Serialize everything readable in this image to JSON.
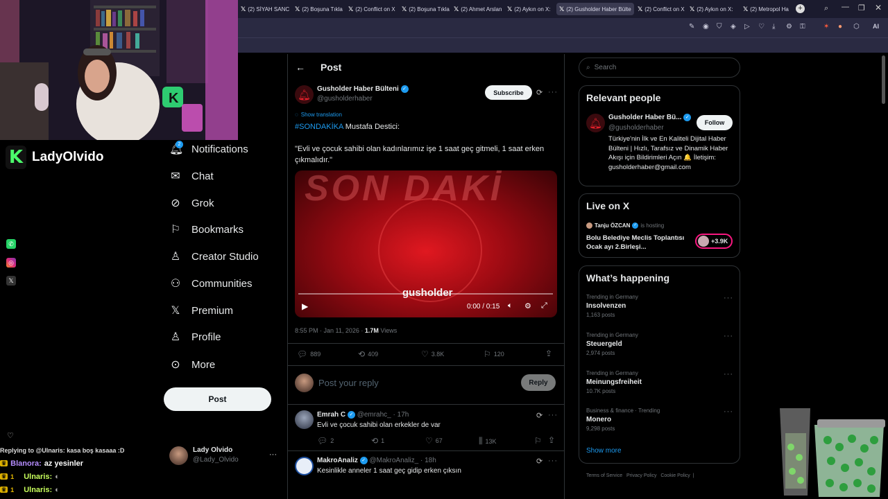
{
  "browser": {
    "tabs": [
      "(2) SİYAH SANC",
      "(2) Boşuna Tıkla",
      "(2) Conflict on X",
      "(2) Boşuna Tıkla",
      "(2) Ahmet Arslan",
      "(2) Aykın on X:",
      "(2) Gusholder Haber Bülte",
      "(2) Conflict on X",
      "(2) Aykın on X:",
      "(2) Metropol Ha"
    ],
    "active_tab_index": 6,
    "new_tab": "+",
    "ai_label": "AI"
  },
  "stream": {
    "streamer": "LadyOlvido",
    "logo_letter": "K",
    "chat": [
      {
        "user": "Replying to @Ulnaris: kasa boş kasaaa :D",
        "color": "#dddddd"
      },
      {
        "user": "Blanora:",
        "text": "az yesinler",
        "color": "#b58cff"
      },
      {
        "user": "Ulnaris:",
        "text": "",
        "color": "#c8ff5c"
      },
      {
        "user": "Ulnaris:",
        "text": "",
        "color": "#c8ff5c"
      }
    ],
    "badge": "1"
  },
  "nav": {
    "notifications": "Notifications",
    "notifications_badge": "2",
    "chat": "Chat",
    "grok": "Grok",
    "bookmarks": "Bookmarks",
    "creator_studio": "Creator Studio",
    "communities": "Communities",
    "premium": "Premium",
    "profile": "Profile",
    "more": "More",
    "post": "Post",
    "account_name": "Lady Olvido",
    "account_handle": "@Lady_Olvido"
  },
  "post": {
    "header": "Post",
    "author": "Gusholder Haber Bülteni",
    "handle": "@gusholderhaber",
    "subscribe": "Subscribe",
    "show_translation": "Show translation",
    "hashtag": "#SONDAKİKA",
    "text_line1": " Mustafa Destici:",
    "quote": "\"Evli ve çocuk sahibi olan kadınlarımız işe 1 saat geç gitmeli, 1 saat erken çıkmalıdır.\"",
    "video_brand": "gusholder",
    "video_overlay_text": "SON DAKİ",
    "video_time": "0:00 / 0:15",
    "video_progress": 0,
    "timestamp": "8:55 PM · Jan 11, 2026 · ",
    "views_count": "1.7M",
    "views_label": " Views",
    "replies": "889",
    "reposts": "409",
    "likes": "3.8K",
    "bookmarks": "120",
    "reply_placeholder": "Post your reply",
    "reply_button": "Reply"
  },
  "replies": [
    {
      "name": "Emrah C",
      "handle": "@emrahc_",
      "time": "· 17h",
      "text": "Evli ve çocuk sahibi olan erkekler de var",
      "replies": "2",
      "reposts": "1",
      "likes": "67",
      "views": "13K"
    },
    {
      "name": "MakroAnaliz",
      "handle": "@MakroAnaliz_",
      "time": "· 18h",
      "text": "Kesinlikle anneler 1 saat geç gidip erken çıksın"
    }
  ],
  "sidebar": {
    "search_placeholder": "Search",
    "relevant_title": "Relevant people",
    "rp_name": "Gusholder Haber Bü...",
    "rp_handle": "@gusholderhaber",
    "rp_follow": "Follow",
    "rp_bio": "Türkiye'nin İlk ve En Kaliteli Dijital Haber Bülteni | Hızlı, Tarafsız ve Dinamik Haber Akışı için Bildirimleri Açın 🔔 İletişim: gusholderhaber@gmail.com",
    "live_title": "Live on X",
    "live_host": "Tanju ÖZCAN",
    "live_hosting": "is hosting",
    "live_title_text": "Bolu Belediye Meclis Toplantısı Ocak ayı 2.Birleşi...",
    "live_count": "+3.9K",
    "happening_title": "What’s happening",
    "trends": [
      {
        "context": "Trending in Germany",
        "name": "Insolvenzen",
        "posts": "1,163 posts"
      },
      {
        "context": "Trending in Germany",
        "name": "Steuergeld",
        "posts": "2,974 posts"
      },
      {
        "context": "Trending in Germany",
        "name": "Meinungsfreiheit",
        "posts": "10.7K posts"
      },
      {
        "context": "Business & finance · Trending",
        "name": "Monero",
        "posts": "9,298 posts"
      }
    ],
    "show_more": "Show more",
    "footer": "Terms of Service   Privacy Policy   Cookie Policy  |"
  },
  "colors": {
    "accent": "#1d9bf0",
    "bg": "#000000",
    "border": "#2f3336",
    "video_red": "#c8101a"
  }
}
